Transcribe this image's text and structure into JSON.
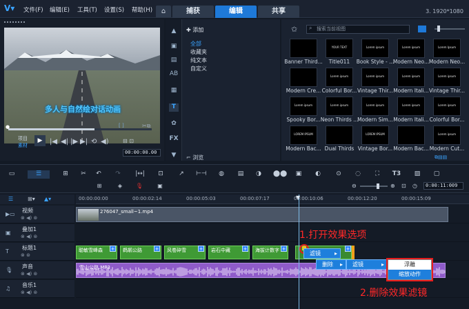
{
  "menubar": {
    "file": "文件(F)",
    "edit": "编辑(E)",
    "tools": "工具(T)",
    "settings": "设置(S)",
    "help": "帮助(H)"
  },
  "tabs": {
    "capture": "捕获",
    "edit": "编辑",
    "share": "共享"
  },
  "resolution": "3. 1920*1080",
  "preview": {
    "caption": "多人与自然绘对话动画",
    "project_label": "项目",
    "clip_label": "素材",
    "timecode": "00:00:00.00",
    "dot_bracket": "[    ]"
  },
  "library": {
    "add_label": "添加",
    "categories": [
      "全部",
      "收藏夹",
      "纯文本",
      "自定义"
    ],
    "browse_label": "浏览",
    "search_placeholder": "搜索当前视图"
  },
  "thumbnails": [
    {
      "label": "Banner Third...",
      "text": ""
    },
    {
      "label": "Title011",
      "text": "YOUR TEXT"
    },
    {
      "label": "Book Style - ...",
      "text": "Lorem ipsum"
    },
    {
      "label": "Modern Neo...",
      "text": "Lorem ipsum"
    },
    {
      "label": "Modern Neo...",
      "text": "Lorem Ipsum"
    },
    {
      "label": "Modern Cre...",
      "text": ""
    },
    {
      "label": "Colorful Bor...",
      "text": "Lorem ipsum"
    },
    {
      "label": "Vintage Thir...",
      "text": "Lorem ipsum"
    },
    {
      "label": "Modern Itali...",
      "text": "Lorem ipsum"
    },
    {
      "label": "Vintage Thir...",
      "text": "Lorem ipsum"
    },
    {
      "label": "Spooky Bor...",
      "text": "Lorem ipsum"
    },
    {
      "label": "Neon Thirds ...",
      "text": "Lorem ipsum"
    },
    {
      "label": "Modern Sim...",
      "text": "Lorem ipsum"
    },
    {
      "label": "Modern Itali...",
      "text": "Lorem ipsum"
    },
    {
      "label": "Colorful Bor...",
      "text": "Lorem ipsum"
    },
    {
      "label": "Modern Bac...",
      "text": "LOREM IPSUM"
    },
    {
      "label": "Dual Thirds",
      "text": ""
    },
    {
      "label": "Vintage Bor...",
      "text": "LOREM IPSUM"
    },
    {
      "label": "Modern Bac...",
      "text": ""
    },
    {
      "label": "Modern Cut...",
      "text": "Lorem ipsum"
    }
  ],
  "timeline": {
    "timecode": "0:00:11:009",
    "ruler": [
      "00:00:00:00",
      "00:00:02:14",
      "00:00:05:03",
      "00:00:07:17",
      "00:00:10:06",
      "00:00:12:20",
      "00:00:15:09"
    ],
    "tracks": [
      "视频",
      "叠加1",
      "标题1",
      "声音",
      "音乐1"
    ],
    "video_clip": "276047_small~1.mp4",
    "title_clips": [
      "聪敏雪峰森",
      "鹈鹕公路",
      "风卷碎雪",
      "岩石中藏",
      "海拔计数字"
    ],
    "audio_clip": "雪山公路.MP3"
  },
  "context_menu": {
    "filter": "滤镜",
    "delete": "删除",
    "filter2": "滤镜",
    "float": "浮雕",
    "zoom_motion": "缩放动作"
  },
  "annotations": {
    "step1": "1.打开效果选项",
    "step2": "2.删除效果滤镜"
  },
  "colors": {
    "accent": "#1e79d8",
    "clip_green": "#3f9a35",
    "audio_purple": "#8f5bc9",
    "annotation_red": "#e81c1c"
  }
}
